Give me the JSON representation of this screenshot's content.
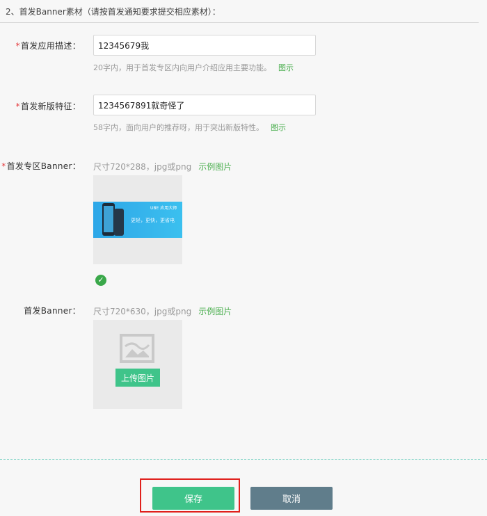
{
  "section": {
    "title": "2、首发Banner素材（请按首发通知要求提交相应素材）："
  },
  "app_description": {
    "required_mark": "*",
    "label": "首发应用描述：",
    "value": "12345679我",
    "hint": "20字内，用于首发专区内向用户介绍应用主要功能。",
    "example_link": "图示"
  },
  "new_version_feature": {
    "required_mark": "*",
    "label": "首发新版特征：",
    "value": "1234567891就奇怪了",
    "hint": "58字内，面向用户的推荐呀，用于突出新版特性。",
    "example_link": "图示"
  },
  "zone_banner": {
    "required_mark": "*",
    "label": "首发专区Banner：",
    "spec": "尺寸720*288，jpg或png",
    "example_link": "示例图片",
    "preview": {
      "brand": "UBE 应用大师",
      "slogan": "更轻，更快，更省电"
    },
    "uploaded_icon": "check-circle-icon"
  },
  "banner": {
    "label": "首发Banner：",
    "spec": "尺寸720*630，jpg或png",
    "example_link": "示例图片",
    "upload_button": "上传图片",
    "placeholder_icon": "image-placeholder-icon"
  },
  "actions": {
    "save": "保存",
    "cancel": "取消"
  },
  "colors": {
    "primary_green": "#3fc48a",
    "cancel_gray": "#607d8b",
    "link_green": "#4caf50",
    "required_red": "#e4393c",
    "highlight_red": "#e0201c"
  }
}
